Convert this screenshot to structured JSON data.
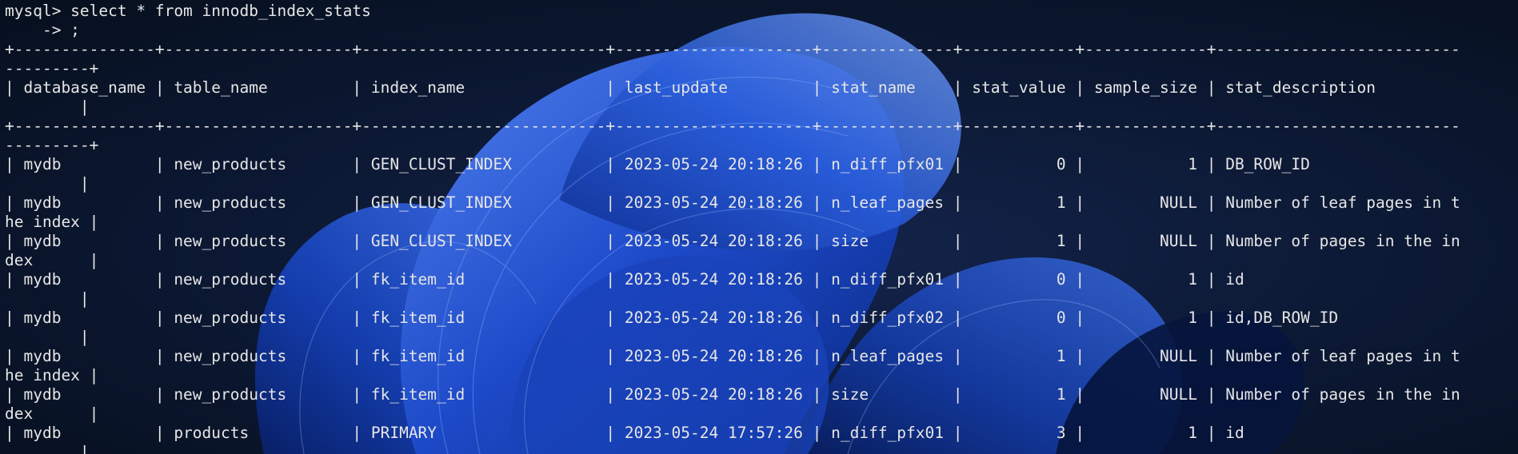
{
  "colors": {
    "background": "#0a1426",
    "text": "#e6e6e6",
    "wallpaper_accent": "#1e4fd1"
  },
  "wallpaper": {
    "icon": "windows-11-bloom-wallpaper"
  },
  "terminal": {
    "lines": [
      "mysql> select * from innodb_index_stats",
      "    -> ;",
      "+---------------+--------------------+--------------------------+---------------------+--------------+------------+-------------+--------------------------",
      "---------+",
      "| database_name | table_name         | index_name               | last_update         | stat_name    | stat_value | sample_size | stat_description",
      "        |",
      "+---------------+--------------------+--------------------------+---------------------+--------------+------------+-------------+--------------------------",
      "---------+",
      "| mydb          | new_products       | GEN_CLUST_INDEX          | 2023-05-24 20:18:26 | n_diff_pfx01 |          0 |           1 | DB_ROW_ID",
      "        |",
      "| mydb          | new_products       | GEN_CLUST_INDEX          | 2023-05-24 20:18:26 | n_leaf_pages |          1 |        NULL | Number of leaf pages in t",
      "he index |",
      "| mydb          | new_products       | GEN_CLUST_INDEX          | 2023-05-24 20:18:26 | size         |          1 |        NULL | Number of pages in the in",
      "dex      |",
      "| mydb          | new_products       | fk_item_id               | 2023-05-24 20:18:26 | n_diff_pfx01 |          0 |           1 | id",
      "        |",
      "| mydb          | new_products       | fk_item_id               | 2023-05-24 20:18:26 | n_diff_pfx02 |          0 |           1 | id,DB_ROW_ID",
      "        |",
      "| mydb          | new_products       | fk_item_id               | 2023-05-24 20:18:26 | n_leaf_pages |          1 |        NULL | Number of leaf pages in t",
      "he index |",
      "| mydb          | new_products       | fk_item_id               | 2023-05-24 20:18:26 | size         |          1 |        NULL | Number of pages in the in",
      "dex      |",
      "| mydb          | products           | PRIMARY                  | 2023-05-24 17:57:26 | n_diff_pfx01 |          3 |           1 | id",
      "        |"
    ]
  }
}
